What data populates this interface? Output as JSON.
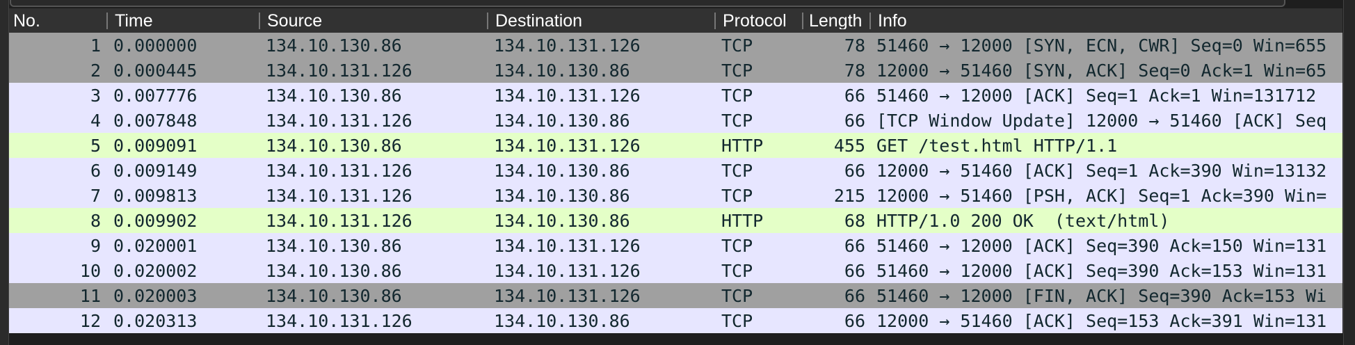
{
  "columns": {
    "no": "No.",
    "time": "Time",
    "source": "Source",
    "destination": "Destination",
    "protocol": "Protocol",
    "length": "Length",
    "info": "Info"
  },
  "colors": {
    "tcp_flags": "#a0a0a0",
    "tcp": "#e7e6ff",
    "http": "#e4ffc7",
    "text": "#12272e"
  },
  "packets": [
    {
      "no": "1",
      "time": "0.000000",
      "source": "134.10.130.86",
      "destination": "134.10.131.126",
      "protocol": "TCP",
      "length": "78",
      "info": "51460 → 12000 [SYN, ECN, CWR] Seq=0 Win=655",
      "color": "#a0a0a0"
    },
    {
      "no": "2",
      "time": "0.000445",
      "source": "134.10.131.126",
      "destination": "134.10.130.86",
      "protocol": "TCP",
      "length": "78",
      "info": "12000 → 51460 [SYN, ACK] Seq=0 Ack=1 Win=65",
      "color": "#a0a0a0"
    },
    {
      "no": "3",
      "time": "0.007776",
      "source": "134.10.130.86",
      "destination": "134.10.131.126",
      "protocol": "TCP",
      "length": "66",
      "info": "51460 → 12000 [ACK] Seq=1 Ack=1 Win=131712",
      "color": "#e7e6ff"
    },
    {
      "no": "4",
      "time": "0.007848",
      "source": "134.10.131.126",
      "destination": "134.10.130.86",
      "protocol": "TCP",
      "length": "66",
      "info": "[TCP Window Update] 12000 → 51460 [ACK] Seq",
      "color": "#e7e6ff"
    },
    {
      "no": "5",
      "time": "0.009091",
      "source": "134.10.130.86",
      "destination": "134.10.131.126",
      "protocol": "HTTP",
      "length": "455",
      "info": "GET /test.html HTTP/1.1",
      "color": "#e4ffc7"
    },
    {
      "no": "6",
      "time": "0.009149",
      "source": "134.10.131.126",
      "destination": "134.10.130.86",
      "protocol": "TCP",
      "length": "66",
      "info": "12000 → 51460 [ACK] Seq=1 Ack=390 Win=13132",
      "color": "#e7e6ff"
    },
    {
      "no": "7",
      "time": "0.009813",
      "source": "134.10.131.126",
      "destination": "134.10.130.86",
      "protocol": "TCP",
      "length": "215",
      "info": "12000 → 51460 [PSH, ACK] Seq=1 Ack=390 Win=",
      "color": "#e7e6ff"
    },
    {
      "no": "8",
      "time": "0.009902",
      "source": "134.10.131.126",
      "destination": "134.10.130.86",
      "protocol": "HTTP",
      "length": "68",
      "info": "HTTP/1.0 200 OK  (text/html)",
      "color": "#e4ffc7"
    },
    {
      "no": "9",
      "time": "0.020001",
      "source": "134.10.130.86",
      "destination": "134.10.131.126",
      "protocol": "TCP",
      "length": "66",
      "info": "51460 → 12000 [ACK] Seq=390 Ack=150 Win=131",
      "color": "#e7e6ff"
    },
    {
      "no": "10",
      "time": "0.020002",
      "source": "134.10.130.86",
      "destination": "134.10.131.126",
      "protocol": "TCP",
      "length": "66",
      "info": "51460 → 12000 [ACK] Seq=390 Ack=153 Win=131",
      "color": "#e7e6ff"
    },
    {
      "no": "11",
      "time": "0.020003",
      "source": "134.10.130.86",
      "destination": "134.10.131.126",
      "protocol": "TCP",
      "length": "66",
      "info": "51460 → 12000 [FIN, ACK] Seq=390 Ack=153 Wi",
      "color": "#a0a0a0"
    },
    {
      "no": "12",
      "time": "0.020313",
      "source": "134.10.131.126",
      "destination": "134.10.130.86",
      "protocol": "TCP",
      "length": "66",
      "info": "12000 → 51460 [ACK] Seq=153 Ack=391 Win=131",
      "color": "#e7e6ff"
    }
  ]
}
